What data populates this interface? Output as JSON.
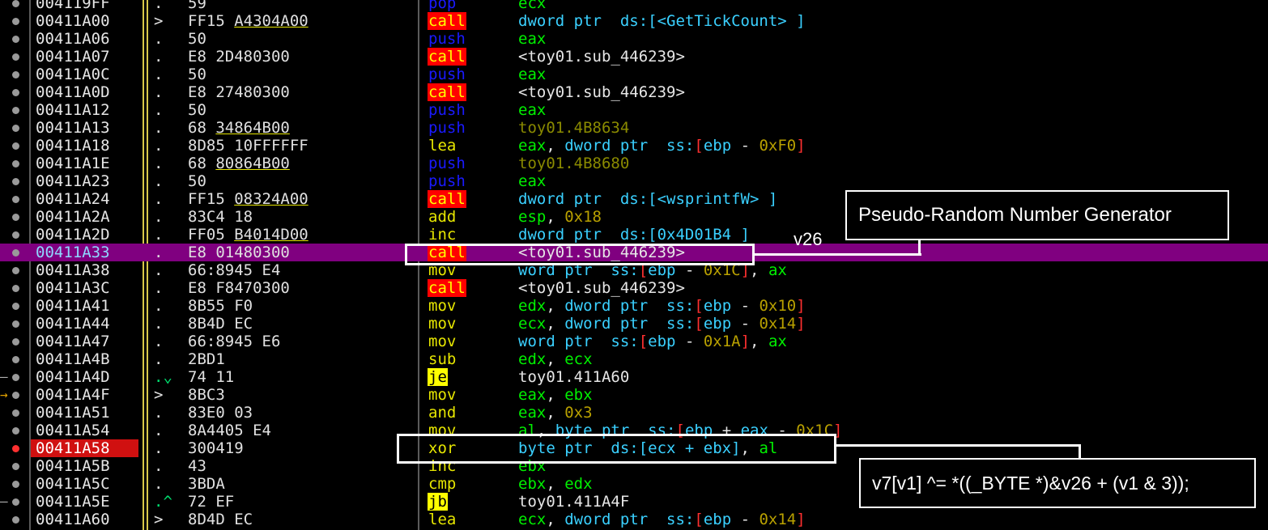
{
  "rows": [
    {
      "addr": "004119FF",
      "mark": ".",
      "bytes": [
        [
          "59",
          false
        ]
      ],
      "mnem": "pop",
      "ops": [
        [
          "ecx",
          "reg"
        ]
      ]
    },
    {
      "addr": "00411A00",
      "mark": ">",
      "bytes": [
        [
          "FF15 ",
          false
        ],
        [
          "A4304A00",
          true
        ]
      ],
      "mnem": "call",
      "ops": [
        [
          "dword ptr",
          "kw"
        ],
        [
          "  ds:[<GetTickCount> ]",
          "kw"
        ]
      ]
    },
    {
      "addr": "00411A06",
      "mark": ".",
      "bytes": [
        [
          "50",
          false
        ]
      ],
      "mnem": "push",
      "ops": [
        [
          "eax",
          "reg"
        ]
      ]
    },
    {
      "addr": "00411A07",
      "mark": ".",
      "bytes": [
        [
          "E8 2D480300",
          false
        ]
      ],
      "mnem": "call",
      "ops": [
        [
          "<toy01.sub_446239>",
          "w"
        ]
      ]
    },
    {
      "addr": "00411A0C",
      "mark": ".",
      "bytes": [
        [
          "50",
          false
        ]
      ],
      "mnem": "push",
      "ops": [
        [
          "eax",
          "reg"
        ]
      ]
    },
    {
      "addr": "00411A0D",
      "mark": ".",
      "bytes": [
        [
          "E8 27480300",
          false
        ]
      ],
      "mnem": "call",
      "ops": [
        [
          "<toy01.sub_446239>",
          "w"
        ]
      ]
    },
    {
      "addr": "00411A12",
      "mark": ".",
      "bytes": [
        [
          "50",
          false
        ]
      ],
      "mnem": "push",
      "ops": [
        [
          "eax",
          "reg"
        ]
      ]
    },
    {
      "addr": "00411A13",
      "mark": ".",
      "bytes": [
        [
          "68 ",
          false
        ],
        [
          "34864B00",
          true
        ]
      ],
      "mnem": "push",
      "ops": [
        [
          "toy01.4B8634",
          "lbl"
        ]
      ]
    },
    {
      "addr": "00411A18",
      "mark": ".",
      "bytes": [
        [
          "8D85 10FFFFFF",
          false
        ]
      ],
      "mnem": "lea",
      "ops": [
        [
          "eax",
          "reg"
        ],
        [
          ", ",
          "w"
        ],
        [
          "dword ptr",
          "kw"
        ],
        [
          "  ss:",
          "kw"
        ],
        [
          "[",
          "br"
        ],
        [
          "ebp",
          "kw"
        ],
        [
          " - ",
          "w"
        ],
        [
          "0xF0",
          "num"
        ],
        [
          "]",
          "br"
        ]
      ]
    },
    {
      "addr": "00411A1E",
      "mark": ".",
      "bytes": [
        [
          "68 ",
          false
        ],
        [
          "80864B00",
          true
        ]
      ],
      "mnem": "push",
      "ops": [
        [
          "toy01.4B8680",
          "lbl"
        ]
      ]
    },
    {
      "addr": "00411A23",
      "mark": ".",
      "bytes": [
        [
          "50",
          false
        ]
      ],
      "mnem": "push",
      "ops": [
        [
          "eax",
          "reg"
        ]
      ]
    },
    {
      "addr": "00411A24",
      "mark": ".",
      "bytes": [
        [
          "FF15 ",
          false
        ],
        [
          "08324A00",
          true
        ]
      ],
      "mnem": "call",
      "ops": [
        [
          "dword ptr",
          "kw"
        ],
        [
          "  ds:[<wsprintfW> ]",
          "kw"
        ]
      ]
    },
    {
      "addr": "00411A2A",
      "mark": ".",
      "bytes": [
        [
          "83C4 18",
          false
        ]
      ],
      "mnem": "add",
      "ops": [
        [
          "esp",
          "reg"
        ],
        [
          ", ",
          "w"
        ],
        [
          "0x18",
          "num"
        ]
      ]
    },
    {
      "addr": "00411A2D",
      "mark": ".",
      "bytes": [
        [
          "FF05 ",
          false
        ],
        [
          "B4014D00",
          true
        ]
      ],
      "mnem": "inc",
      "ops": [
        [
          "dword ptr",
          "kw"
        ],
        [
          "  ds:[0x4D01B4 ]",
          "kw"
        ]
      ]
    },
    {
      "addr": "00411A33",
      "mark": ".",
      "bytes": [
        [
          "E8 01480300",
          false
        ]
      ],
      "mnem": "call",
      "ops": [
        [
          "<toy01.sub_446239>",
          "w"
        ]
      ],
      "selected": true
    },
    {
      "addr": "00411A38",
      "mark": ".",
      "bytes": [
        [
          "66:8945 E4",
          false
        ]
      ],
      "mnem": "mov",
      "ops": [
        [
          "word ptr",
          "kw"
        ],
        [
          "  ss:",
          "kw"
        ],
        [
          "[",
          "br"
        ],
        [
          "ebp",
          "kw"
        ],
        [
          " - ",
          "w"
        ],
        [
          "0x1C",
          "num"
        ],
        [
          "]",
          "br"
        ],
        [
          ", ",
          "w"
        ],
        [
          "ax",
          "reg"
        ]
      ]
    },
    {
      "addr": "00411A3C",
      "mark": ".",
      "bytes": [
        [
          "E8 F8470300",
          false
        ]
      ],
      "mnem": "call",
      "ops": [
        [
          "<toy01.sub_446239>",
          "w"
        ]
      ]
    },
    {
      "addr": "00411A41",
      "mark": ".",
      "bytes": [
        [
          "8B55 F0",
          false
        ]
      ],
      "mnem": "mov",
      "ops": [
        [
          "edx",
          "reg"
        ],
        [
          ", ",
          "w"
        ],
        [
          "dword ptr",
          "kw"
        ],
        [
          "  ss:",
          "kw"
        ],
        [
          "[",
          "br"
        ],
        [
          "ebp",
          "kw"
        ],
        [
          " - ",
          "w"
        ],
        [
          "0x10",
          "num"
        ],
        [
          "]",
          "br"
        ]
      ]
    },
    {
      "addr": "00411A44",
      "mark": ".",
      "bytes": [
        [
          "8B4D EC",
          false
        ]
      ],
      "mnem": "mov",
      "ops": [
        [
          "ecx",
          "reg"
        ],
        [
          ", ",
          "w"
        ],
        [
          "dword ptr",
          "kw"
        ],
        [
          "  ss:",
          "kw"
        ],
        [
          "[",
          "br"
        ],
        [
          "ebp",
          "kw"
        ],
        [
          " - ",
          "w"
        ],
        [
          "0x14",
          "num"
        ],
        [
          "]",
          "br"
        ]
      ]
    },
    {
      "addr": "00411A47",
      "mark": ".",
      "bytes": [
        [
          "66:8945 E6",
          false
        ]
      ],
      "mnem": "mov",
      "ops": [
        [
          "word ptr",
          "kw"
        ],
        [
          "  ss:",
          "kw"
        ],
        [
          "[",
          "br"
        ],
        [
          "ebp",
          "kw"
        ],
        [
          " - ",
          "w"
        ],
        [
          "0x1A",
          "num"
        ],
        [
          "]",
          "br"
        ],
        [
          ", ",
          "w"
        ],
        [
          "ax",
          "reg"
        ]
      ]
    },
    {
      "addr": "00411A4B",
      "mark": ".",
      "bytes": [
        [
          "2BD1",
          false
        ]
      ],
      "mnem": "sub",
      "ops": [
        [
          "edx",
          "reg"
        ],
        [
          ", ",
          "w"
        ],
        [
          "ecx",
          "reg"
        ]
      ]
    },
    {
      "addr": "00411A4D",
      "mark": ".⌄",
      "bytes": [
        [
          "74 11",
          false
        ]
      ],
      "mnem": "je",
      "ops": [
        [
          "toy01.411A60",
          "w"
        ]
      ],
      "gutter": "–"
    },
    {
      "addr": "00411A4F",
      "mark": ">",
      "bytes": [
        [
          "8BC3",
          false
        ]
      ],
      "mnem": "mov",
      "ops": [
        [
          "eax",
          "reg"
        ],
        [
          ", ",
          "w"
        ],
        [
          "ebx",
          "reg"
        ]
      ],
      "gutter": "→"
    },
    {
      "addr": "00411A51",
      "mark": ".",
      "bytes": [
        [
          "83E0 03",
          false
        ]
      ],
      "mnem": "and",
      "ops": [
        [
          "eax",
          "reg"
        ],
        [
          ", ",
          "w"
        ],
        [
          "0x3",
          "num"
        ]
      ]
    },
    {
      "addr": "00411A54",
      "mark": ".",
      "bytes": [
        [
          "8A4405 E4",
          false
        ]
      ],
      "mnem": "mov",
      "ops": [
        [
          "al",
          "reg"
        ],
        [
          ", ",
          "w"
        ],
        [
          "byte ptr",
          "kw"
        ],
        [
          "  ss:",
          "kw"
        ],
        [
          "[",
          "br"
        ],
        [
          "ebp",
          "kw"
        ],
        [
          " + ",
          "w"
        ],
        [
          "eax",
          "kw"
        ],
        [
          " - ",
          "w"
        ],
        [
          "0x1C",
          "num"
        ],
        [
          "]",
          "br"
        ]
      ]
    },
    {
      "addr": "00411A58",
      "mark": ".",
      "bytes": [
        [
          "300419",
          false
        ]
      ],
      "mnem": "xor",
      "ops": [
        [
          "byte ptr",
          "kw"
        ],
        [
          "  ds:[ecx + ebx]",
          "kw"
        ],
        [
          ", ",
          "w"
        ],
        [
          "al",
          "reg"
        ]
      ],
      "bp": true
    },
    {
      "addr": "00411A5B",
      "mark": ".",
      "bytes": [
        [
          "43",
          false
        ]
      ],
      "mnem": "inc",
      "ops": [
        [
          "ebx",
          "reg"
        ]
      ]
    },
    {
      "addr": "00411A5C",
      "mark": ".",
      "bytes": [
        [
          "3BDA",
          false
        ]
      ],
      "mnem": "cmp",
      "ops": [
        [
          "ebx",
          "reg"
        ],
        [
          ", ",
          "w"
        ],
        [
          "edx",
          "reg"
        ]
      ]
    },
    {
      "addr": "00411A5E",
      "mark": ".^",
      "bytes": [
        [
          "72 EF",
          false
        ]
      ],
      "mnem": "jb",
      "ops": [
        [
          "toy01.411A4F",
          "w"
        ]
      ],
      "gutter": "–"
    },
    {
      "addr": "00411A60",
      "mark": ">",
      "bytes": [
        [
          "8D4D EC",
          false
        ]
      ],
      "mnem": "lea",
      "ops": [
        [
          "ecx",
          "reg"
        ],
        [
          ", ",
          "w"
        ],
        [
          "dword ptr",
          "kw"
        ],
        [
          "  ss:",
          "kw"
        ],
        [
          "[",
          "br"
        ],
        [
          "ebp",
          "kw"
        ],
        [
          " - ",
          "w"
        ],
        [
          "0x14",
          "num"
        ],
        [
          "]",
          "br"
        ]
      ]
    }
  ],
  "annotations": {
    "prng_label": "Pseudo-Random Number Generator",
    "v26_label": "v26",
    "xor_label": "v7[v1] ^= *((_BYTE *)&v26 + (v1 & 3));"
  },
  "colors": {
    "selected_row": "#800080",
    "breakpoint": "#ff3030",
    "call_bg": "#ff0000",
    "jump_bg": "#ffff00"
  }
}
